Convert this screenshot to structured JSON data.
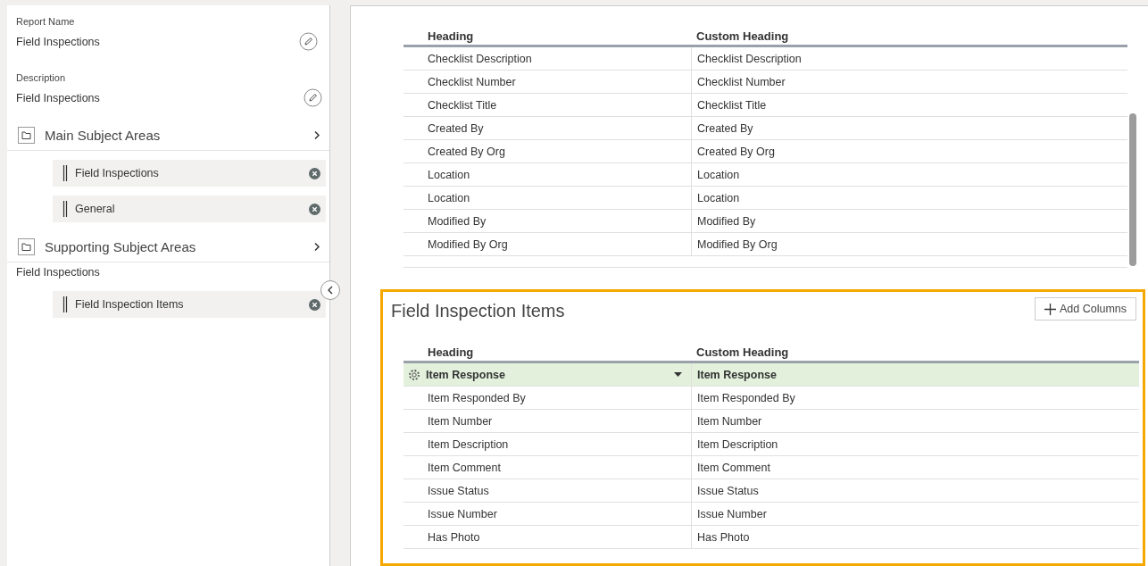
{
  "report_name": {
    "label": "Report Name",
    "value": "Field Inspections"
  },
  "description": {
    "label": "Description",
    "value": "Field Inspections"
  },
  "main_subject_areas": {
    "title": "Main Subject Areas",
    "items": [
      "Field Inspections",
      "General"
    ]
  },
  "supporting_subject_areas": {
    "title": "Supporting Subject Areas",
    "groups": [
      {
        "name": "Field Inspections",
        "items": [
          "Field Inspection Items"
        ]
      }
    ]
  },
  "top_table": {
    "columns": [
      "Heading",
      "Custom Heading"
    ],
    "rows": [
      {
        "heading": "Checklist Description",
        "custom_heading": "Checklist Description"
      },
      {
        "heading": "Checklist Number",
        "custom_heading": "Checklist Number"
      },
      {
        "heading": "Checklist Title",
        "custom_heading": "Checklist Title"
      },
      {
        "heading": "Created By",
        "custom_heading": "Created By"
      },
      {
        "heading": "Created By Org",
        "custom_heading": "Created By Org"
      },
      {
        "heading": "Location",
        "custom_heading": "Location"
      },
      {
        "heading": "Location",
        "custom_heading": "Location"
      },
      {
        "heading": "Modified By",
        "custom_heading": "Modified By"
      },
      {
        "heading": "Modified By Org",
        "custom_heading": "Modified By Org"
      }
    ]
  },
  "field_inspection_items": {
    "title": "Field Inspection Items",
    "add_button": "Add Columns",
    "columns": [
      "Heading",
      "Custom Heading"
    ],
    "rows": [
      {
        "heading": "Item Response",
        "custom_heading": "Item Response",
        "selected": true
      },
      {
        "heading": "Item Responded By",
        "custom_heading": "Item Responded By",
        "selected": false
      },
      {
        "heading": "Item Number",
        "custom_heading": "Item Number",
        "selected": false
      },
      {
        "heading": "Item Description",
        "custom_heading": "Item Description",
        "selected": false
      },
      {
        "heading": "Item Comment",
        "custom_heading": "Item Comment",
        "selected": false
      },
      {
        "heading": "Issue Status",
        "custom_heading": "Issue Status",
        "selected": false
      },
      {
        "heading": "Issue Number",
        "custom_heading": "Issue Number",
        "selected": false
      },
      {
        "heading": "Has Photo",
        "custom_heading": "Has Photo",
        "selected": false
      }
    ]
  }
}
